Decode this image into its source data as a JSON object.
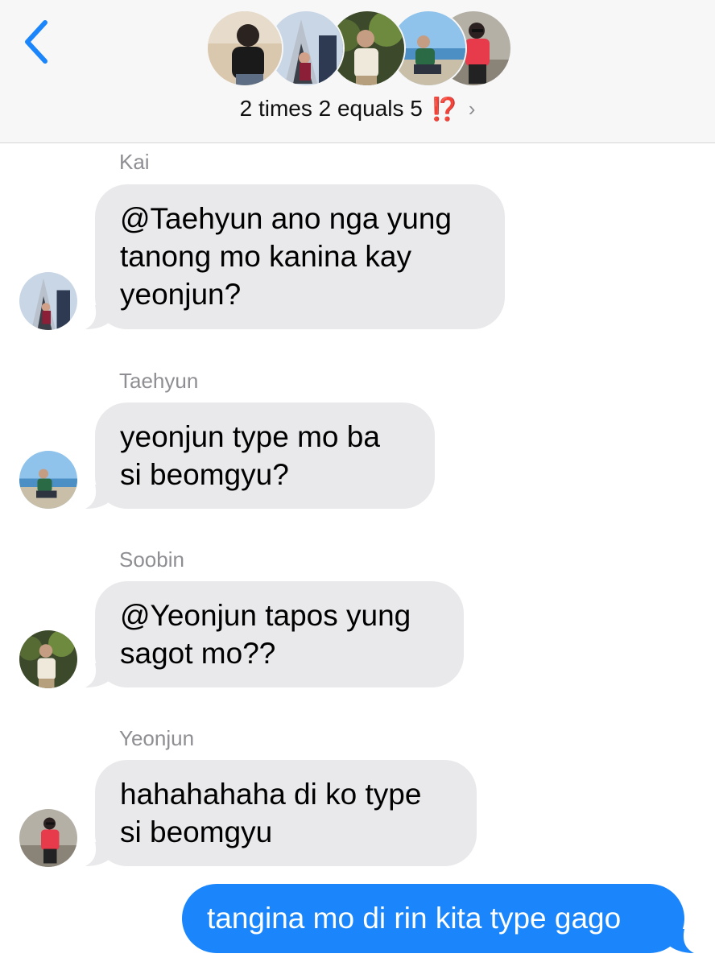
{
  "header": {
    "back_icon": "chevron-left-icon",
    "group_name": "2 times 2 equals 5",
    "badge": "⁉️",
    "chevron": "›",
    "accent_color": "#1b86fb",
    "avatars": [
      "member-1",
      "member-2",
      "member-3",
      "member-4",
      "member-5"
    ]
  },
  "messages": [
    {
      "sender": "Kai",
      "lines": [
        "@Taehyun ano nga yung",
        "tanong mo kanina kay",
        "yeonjun?"
      ]
    },
    {
      "sender": "Taehyun",
      "lines": [
        "yeonjun type mo ba",
        "si beomgyu?"
      ]
    },
    {
      "sender": "Soobin",
      "lines": [
        "@Yeonjun tapos yung",
        "sagot mo??"
      ]
    },
    {
      "sender": "Yeonjun",
      "lines": [
        "hahahahaha di ko type",
        "si beomgyu"
      ]
    }
  ],
  "outgoing": {
    "text": "tangina mo di rin kita type gago"
  },
  "colors": {
    "incoming_bubble": "#e9e9eb",
    "outgoing_bubble": "#1b86fb",
    "sender_label": "#8e8e93"
  }
}
